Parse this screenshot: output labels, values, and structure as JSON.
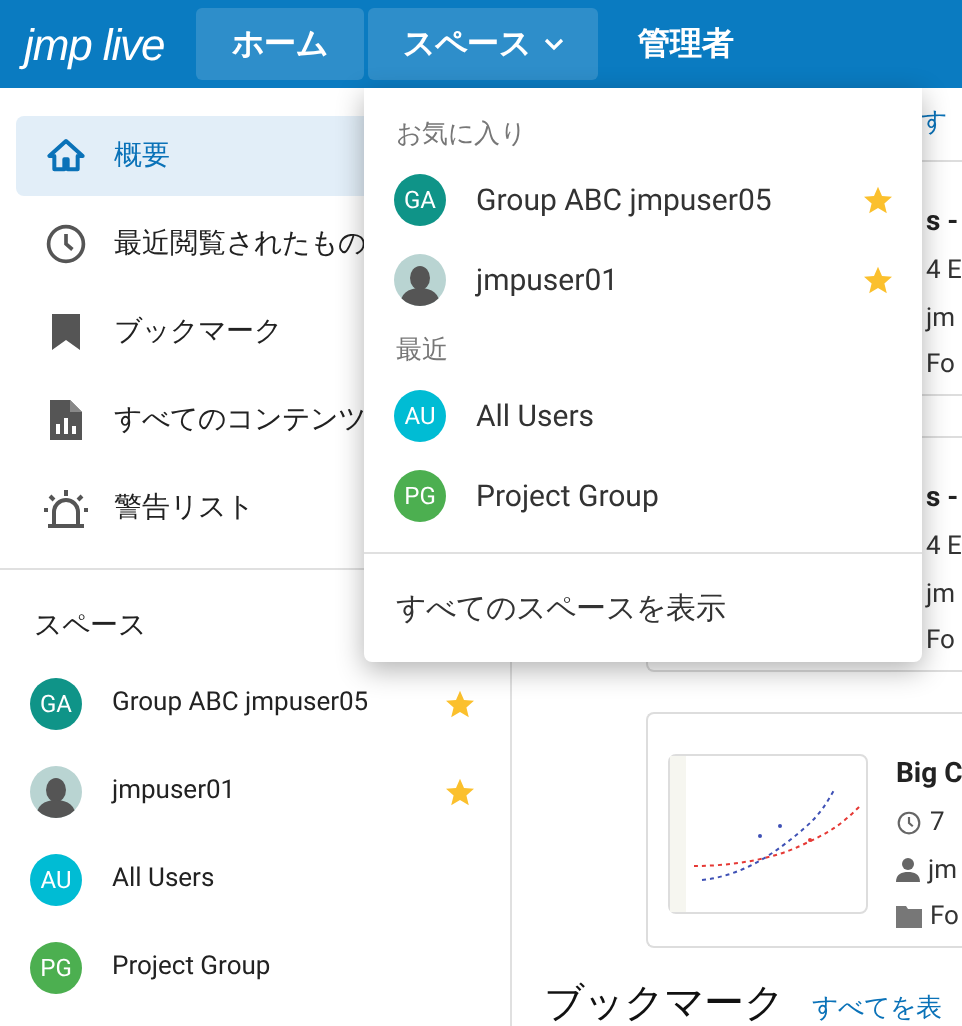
{
  "header": {
    "logo": "jmp live",
    "nav": [
      {
        "label": "ホーム",
        "selected": true,
        "dropdown": false
      },
      {
        "label": "スペース",
        "selected": true,
        "dropdown": true
      },
      {
        "label": "管理者",
        "selected": false,
        "dropdown": false
      }
    ]
  },
  "sidebar": {
    "items": [
      {
        "label": "概要",
        "kind": "home",
        "selected": true
      },
      {
        "label": "最近閲覧されたもの",
        "kind": "clock",
        "selected": false
      },
      {
        "label": "ブックマーク",
        "kind": "bookmark",
        "selected": false
      },
      {
        "label": "すべてのコンテンツ",
        "kind": "report",
        "selected": false
      },
      {
        "label": "警告リスト",
        "kind": "alert",
        "selected": false
      }
    ],
    "spaces_title": "スペース",
    "spaces": [
      {
        "initials": "GA",
        "name": "Group ABC jmpuser05",
        "color": "#0f9488",
        "favorite": true,
        "kind": "initials"
      },
      {
        "name": "jmpuser01",
        "color": "#b9d4d2",
        "favorite": true,
        "kind": "person"
      },
      {
        "initials": "AU",
        "name": "All Users",
        "color": "#00bcd4",
        "favorite": false,
        "kind": "initials"
      },
      {
        "initials": "PG",
        "name": "Project Group",
        "color": "#4caf50",
        "favorite": false,
        "kind": "initials"
      }
    ]
  },
  "main": {
    "top_link": "す",
    "cards": [
      {
        "title": "s -",
        "time": "4 E",
        "author": "jm",
        "folder": "Fo",
        "thumbnail": false
      },
      {
        "title": "s -",
        "time": "4 E",
        "author": "jm",
        "folder": "Fo",
        "thumbnail": false
      },
      {
        "title": "Big C",
        "time": "7",
        "author": "jm",
        "folder": "Fo",
        "thumbnail": true
      }
    ],
    "bookmarks_title": "ブックマーク",
    "bookmarks_link": "すべてを表"
  },
  "dropdown": {
    "sections": [
      {
        "title": "お気に入り",
        "items": [
          {
            "initials": "GA",
            "name": "Group ABC jmpuser05",
            "color": "#0f9488",
            "favorite": true,
            "kind": "initials"
          },
          {
            "name": "jmpuser01",
            "color": "#b9d4d2",
            "favorite": true,
            "kind": "person"
          }
        ]
      },
      {
        "title": "最近",
        "items": [
          {
            "initials": "AU",
            "name": "All Users",
            "color": "#00bcd4",
            "favorite": false,
            "kind": "initials"
          },
          {
            "initials": "PG",
            "name": "Project Group",
            "color": "#4caf50",
            "favorite": false,
            "kind": "initials"
          }
        ]
      }
    ],
    "footer": "すべてのスペースを表示"
  }
}
